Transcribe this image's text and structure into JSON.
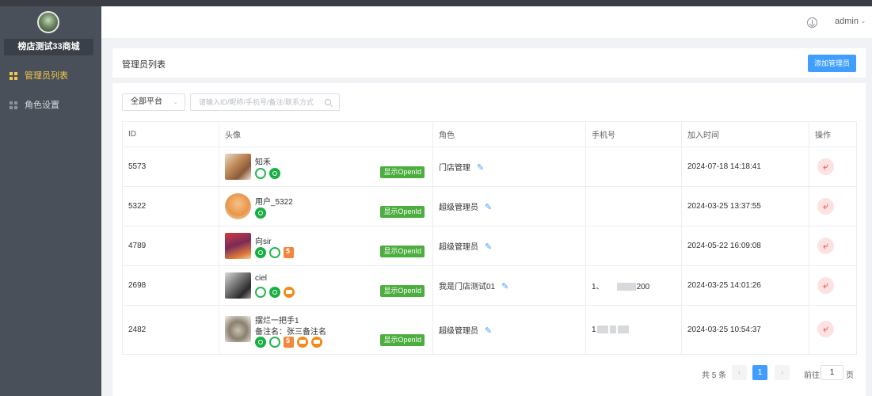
{
  "sidebar": {
    "store_name": "榜店测试33商城",
    "items": [
      {
        "label": "管理员列表",
        "active": true
      },
      {
        "label": "角色设置",
        "active": false
      }
    ]
  },
  "header": {
    "user": "admin",
    "download_icon": "download-icon",
    "caret_icon": "chevron-down-icon"
  },
  "title_bar": {
    "title": "管理员列表",
    "add_button": "添加管理员"
  },
  "filters": {
    "platform_value": "全部平台",
    "search_placeholder": "请输入ID/昵称/手机号/备注/联系方式"
  },
  "table": {
    "columns": [
      "ID",
      "头像",
      "角色",
      "手机号",
      "加入时间",
      "操作"
    ],
    "openid_label": "显示OpenId",
    "rows": [
      {
        "id": "5573",
        "nickname": "知禾",
        "remark": "",
        "platforms": [
          "wechat",
          "miniprogram"
        ],
        "role": "门店管理",
        "phone_prefix": "",
        "phone_suffix": "",
        "joined": "2024-07-18 14:18:41"
      },
      {
        "id": "5322",
        "nickname": "用户_5322",
        "remark": "",
        "platforms": [
          "miniprogram"
        ],
        "role": "超级管理员",
        "phone_prefix": "",
        "phone_suffix": "",
        "joined": "2024-03-25 13:37:55"
      },
      {
        "id": "4789",
        "nickname": "向sir",
        "remark": "",
        "platforms": [
          "miniprogram",
          "wechat",
          "h5"
        ],
        "role": "超级管理员",
        "phone_prefix": "",
        "phone_suffix": "",
        "joined": "2024-05-22 16:09:08"
      },
      {
        "id": "2698",
        "nickname": "ciel",
        "remark": "",
        "platforms": [
          "wechat",
          "miniprogram",
          "pc"
        ],
        "role": "我是门店测试01",
        "phone_prefix": "1、",
        "phone_suffix": "200",
        "joined": "2024-03-25 14:01:26"
      },
      {
        "id": "2482",
        "nickname": "摆烂一把手1",
        "remark": "备注名：张三备注名",
        "platforms": [
          "miniprogram",
          "wechat",
          "h5",
          "pc",
          "pc"
        ],
        "role": "超级管理员",
        "phone_prefix": "1",
        "phone_suffix": "",
        "joined": "2024-03-25 10:54:37"
      }
    ]
  },
  "pagination": {
    "total": "共 5 条",
    "current": "1",
    "goto_label": "前往",
    "goto_value": "1",
    "goto_unit": "页"
  },
  "colors": {
    "sidebar_bg": "#4a5059",
    "active_nav": "#f4c84a",
    "primary": "#409eff",
    "openid_green": "#4cae3f",
    "danger_light": "#fde2e2"
  }
}
